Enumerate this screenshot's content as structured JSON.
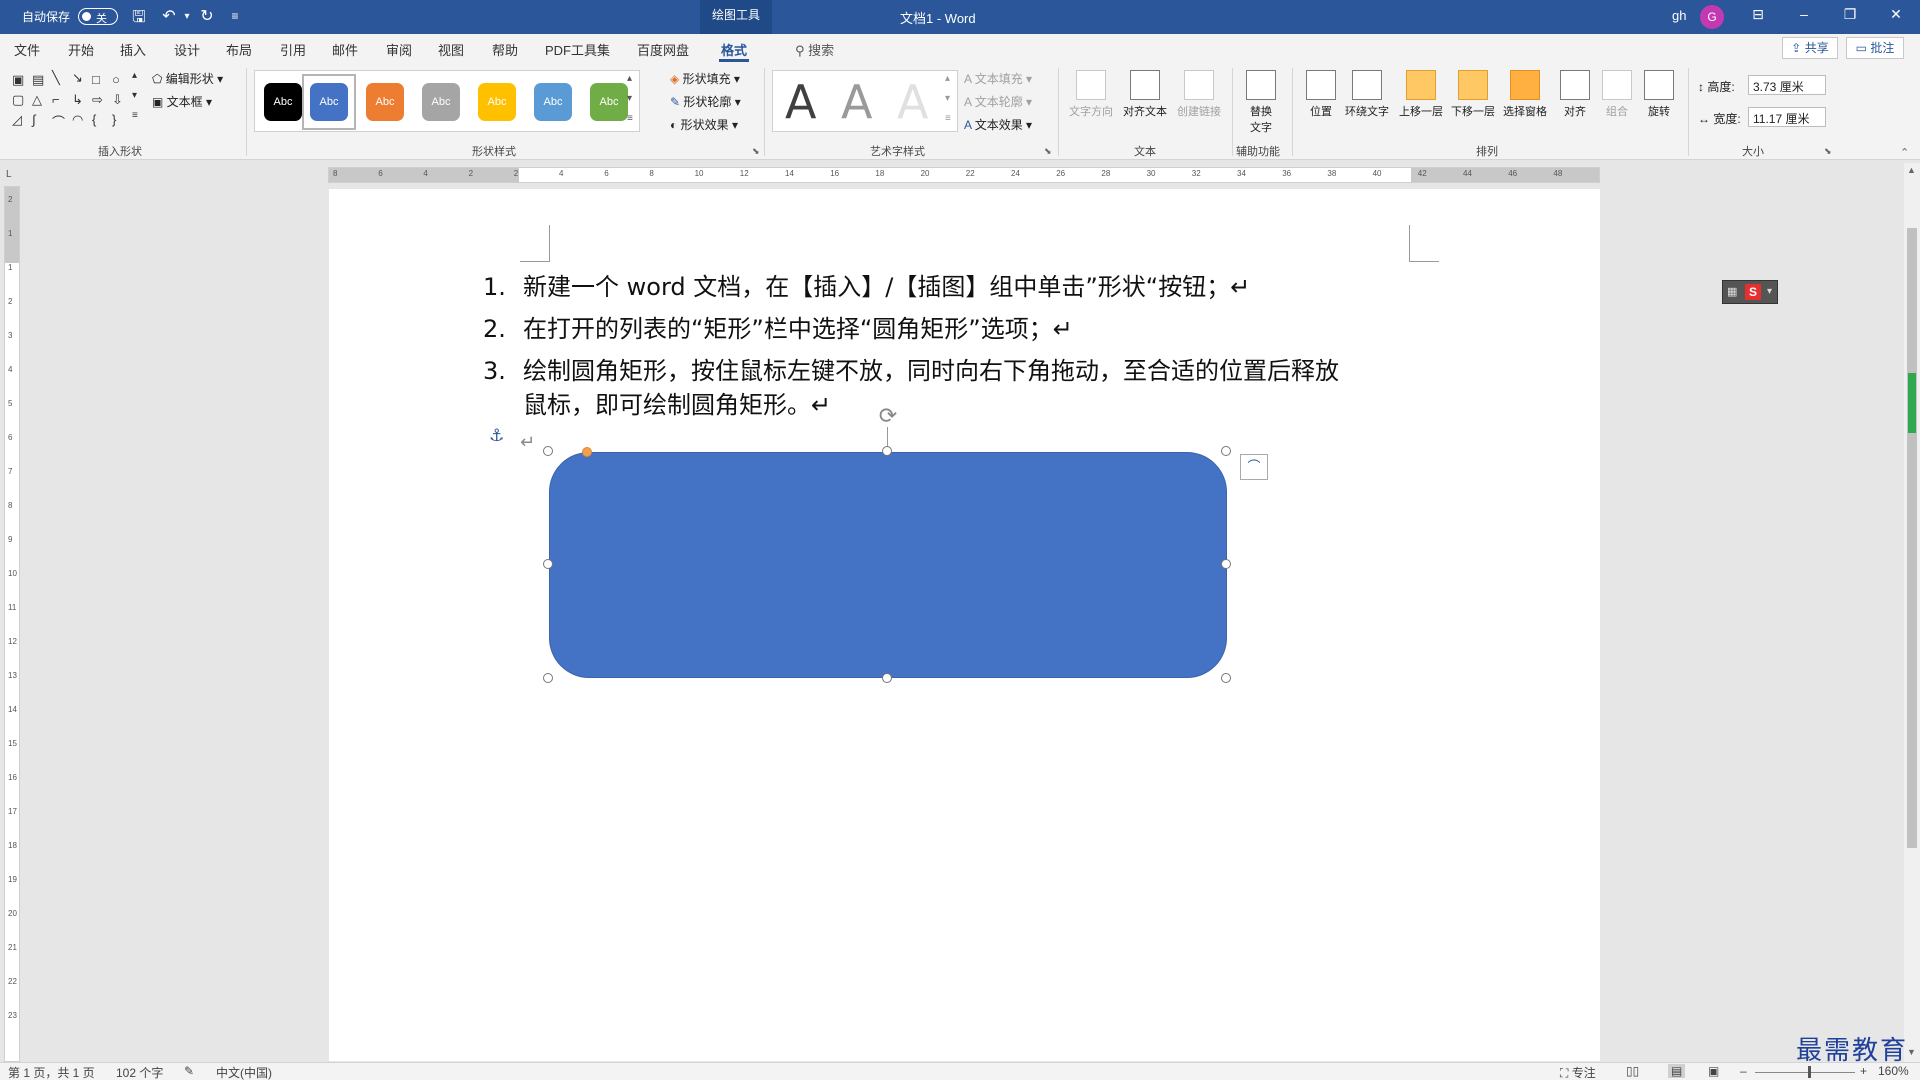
{
  "titlebar": {
    "autosave_label": "自动保存",
    "autosave_state": "关",
    "contextual_tab": "绘图工具",
    "document_title": "文档1  -  Word",
    "user_name": "gh",
    "avatar_letter": "G"
  },
  "tabs": {
    "items": [
      "文件",
      "开始",
      "插入",
      "设计",
      "布局",
      "引用",
      "邮件",
      "审阅",
      "视图",
      "帮助",
      "PDF工具集",
      "百度网盘",
      "格式"
    ],
    "active": "格式",
    "search_label": "搜索",
    "share_label": "共享",
    "comment_label": "批注"
  },
  "ribbon": {
    "insert_shapes": {
      "edit_shape": "编辑形状",
      "text_box": "文本框",
      "group_label": "插入形状"
    },
    "shape_styles": {
      "swatch_label": "Abc",
      "swatch_colors": [
        "#000000",
        "#4472c4",
        "#ed7d31",
        "#a5a5a5",
        "#ffc000",
        "#5b9bd5",
        "#70ad47"
      ],
      "fill": "形状填充",
      "outline": "形状轮廓",
      "effects": "形状效果",
      "group_label": "形状样式"
    },
    "wordart": {
      "letter": "A",
      "text_fill": "文本填充",
      "text_outline": "文本轮廓",
      "text_effects": "文本效果",
      "group_label": "艺术字样式"
    },
    "text": {
      "direction": "文字方向",
      "align": "对齐文本",
      "link": "创建链接",
      "group_label": "文本"
    },
    "accessibility": {
      "alt_text_1": "替换",
      "alt_text_2": "文字",
      "group_label": "辅助功能"
    },
    "arrange": {
      "position": "位置",
      "wrap": "环绕文字",
      "bring_forward": "上移一层",
      "send_backward": "下移一层",
      "selection_pane": "选择窗格",
      "align": "对齐",
      "group": "组合",
      "rotate": "旋转",
      "group_label": "排列"
    },
    "size": {
      "height_label": "高度:",
      "height_value": "3.73 厘米",
      "width_label": "宽度:",
      "width_value": "11.17 厘米",
      "group_label": "大小"
    }
  },
  "ruler": {
    "h_numbers": [
      "8",
      "6",
      "4",
      "2",
      "2",
      "4",
      "6",
      "8",
      "10",
      "12",
      "14",
      "16",
      "18",
      "20",
      "22",
      "24",
      "26",
      "28",
      "30",
      "32",
      "34",
      "36",
      "38",
      "40",
      "42",
      "44",
      "46",
      "48"
    ],
    "v_numbers": [
      "2",
      "1",
      "1",
      "2",
      "3",
      "4",
      "5",
      "6",
      "7",
      "8",
      "9",
      "10",
      "11",
      "12",
      "13",
      "14",
      "15",
      "16",
      "17",
      "18",
      "19",
      "20",
      "21",
      "22",
      "23"
    ]
  },
  "document": {
    "items": [
      {
        "num": "1.",
        "lines": [
          "新建一个 word 文档，在【插入】/【插图】组中单击”形状“按钮；↵"
        ]
      },
      {
        "num": "2.",
        "lines": [
          "在打开的列表的“矩形”栏中选择“圆角矩形”选项；↵"
        ]
      },
      {
        "num": "3.",
        "lines": [
          "绘制圆角矩形，按住鼠标左键不放，同时向右下角拖动，至合适的位置后释放",
          "鼠标，即可绘制圆角矩形。↵"
        ]
      }
    ],
    "empty_paragraph_mark": "↵",
    "shape_color": "#4472c4"
  },
  "statusbar": {
    "page": "第 1 页，共 1 页",
    "words": "102 个字",
    "language": "中文(中国)",
    "focus": "专注",
    "zoom": "160%"
  },
  "watermark": "最需教育"
}
